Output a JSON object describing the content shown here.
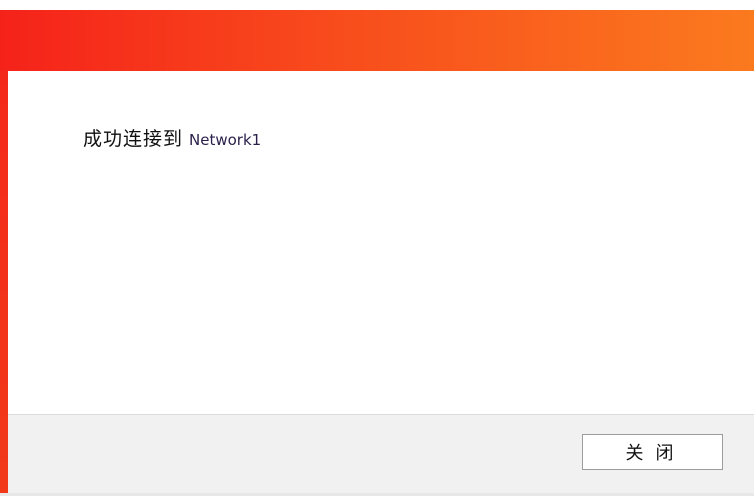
{
  "dialog": {
    "message_prefix": "成功连接到",
    "network_name": "Network1",
    "close_label": "关闭"
  },
  "colors": {
    "titlebar_start": "#f5221a",
    "titlebar_end": "#fb7a1e",
    "footer_bg": "#f1f1f1"
  }
}
